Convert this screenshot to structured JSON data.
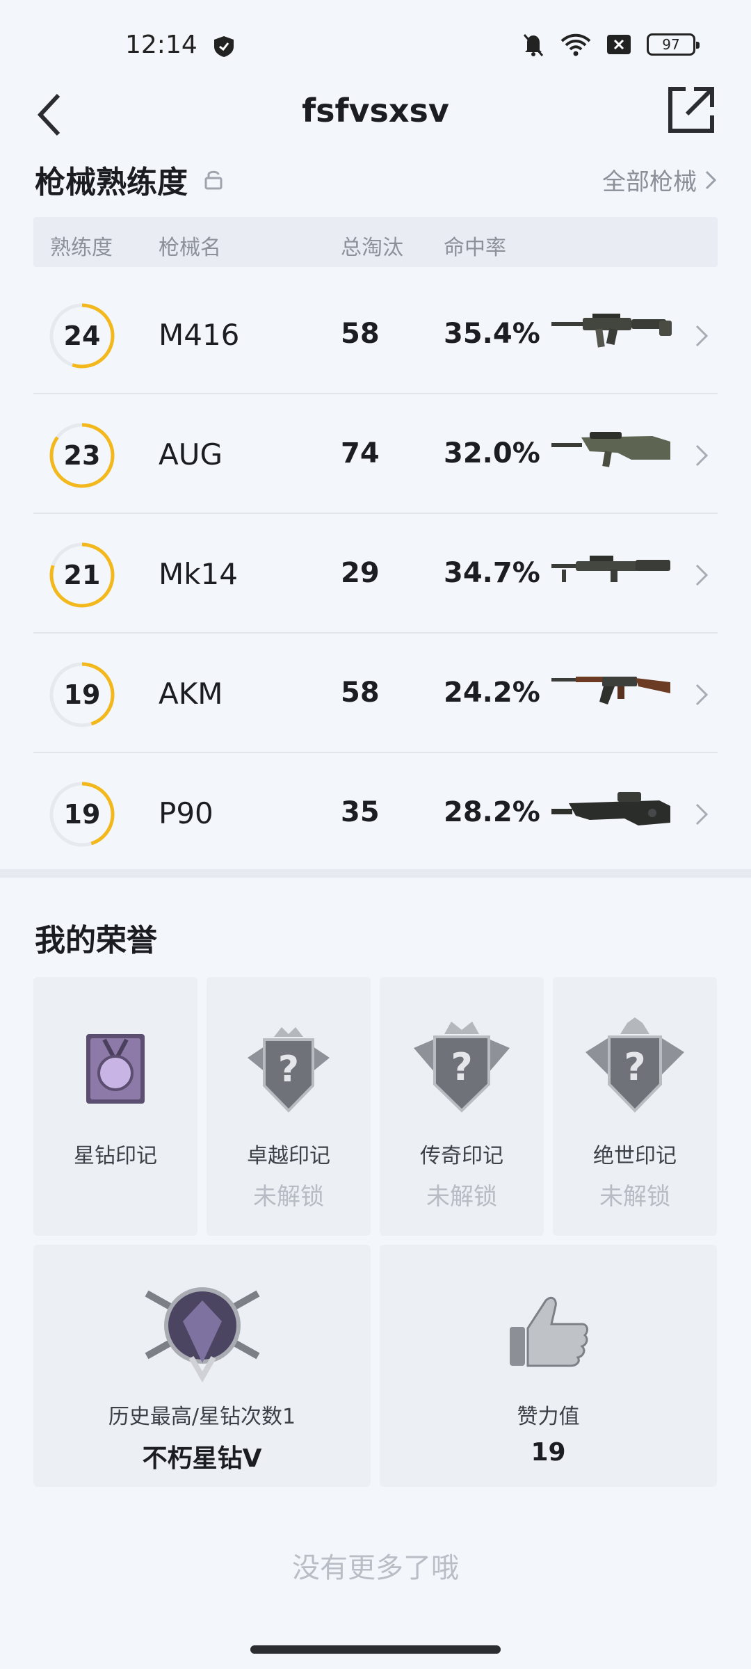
{
  "status": {
    "time": "12:14",
    "battery": "97"
  },
  "nav": {
    "title": "fsfvsxsv"
  },
  "weapons": {
    "section_title": "枪械熟练度",
    "all_link": "全部枪械",
    "headers": {
      "level": "熟练度",
      "name": "枪械名",
      "kills": "总淘汰",
      "rate": "命中率"
    },
    "rows": [
      {
        "level": "24",
        "name": "M416",
        "kills": "58",
        "rate": "35.4%",
        "progress": 0.55
      },
      {
        "level": "23",
        "name": "AUG",
        "kills": "74",
        "rate": "32.0%",
        "progress": 0.85
      },
      {
        "level": "21",
        "name": "Mk14",
        "kills": "29",
        "rate": "34.7%",
        "progress": 0.8
      },
      {
        "level": "19",
        "name": "AKM",
        "kills": "58",
        "rate": "24.2%",
        "progress": 0.45
      },
      {
        "level": "19",
        "name": "P90",
        "kills": "35",
        "rate": "28.2%",
        "progress": 0.45
      }
    ]
  },
  "honors": {
    "section_title": "我的荣誉",
    "marks": [
      {
        "label": "星钻印记",
        "status": ""
      },
      {
        "label": "卓越印记",
        "status": "未解锁"
      },
      {
        "label": "传奇印记",
        "status": "未解锁"
      },
      {
        "label": "绝世印记",
        "status": "未解锁"
      }
    ],
    "rank": {
      "label": "历史最高/星钻次数1",
      "value": "不朽星钻V"
    },
    "likes": {
      "label": "赞力值",
      "value": "19"
    }
  },
  "footer": {
    "no_more": "没有更多了哦"
  },
  "colors": {
    "ring": "#f2b81c",
    "ring_track": "#e6e9ee",
    "background": "#f3f6fa"
  }
}
